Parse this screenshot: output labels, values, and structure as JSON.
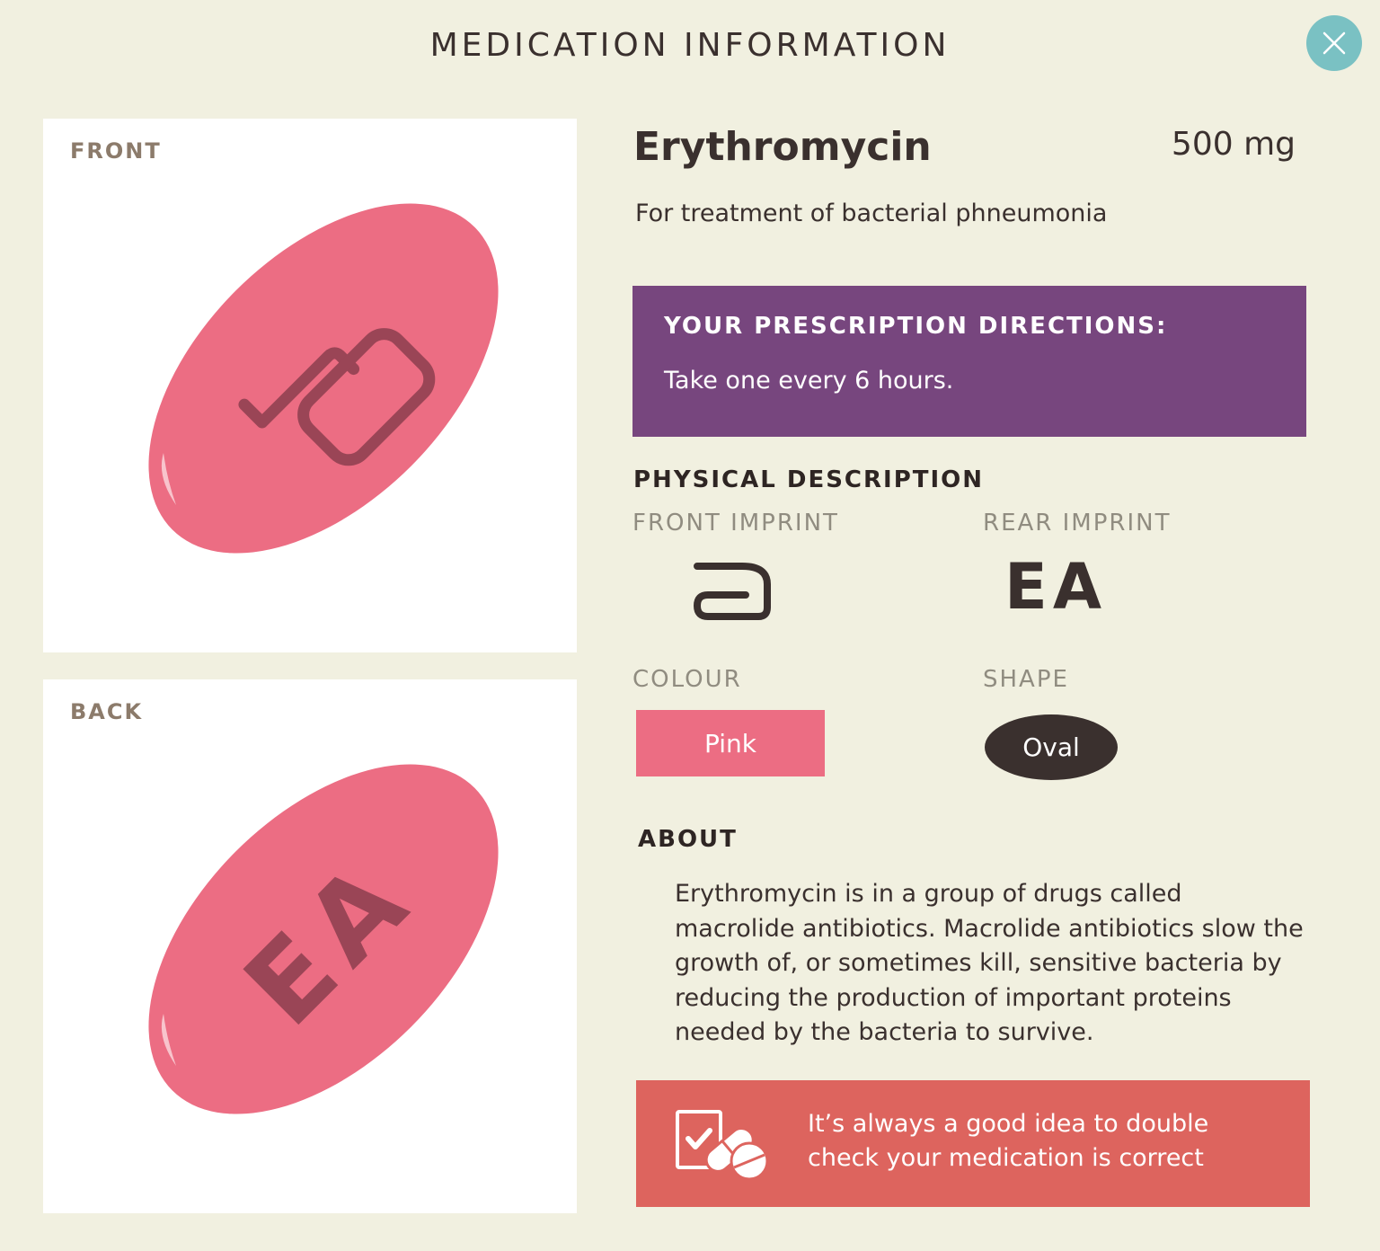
{
  "header": {
    "title": "MEDICATION INFORMATION",
    "close_icon": "close-icon"
  },
  "images": {
    "front_label": "FRONT",
    "back_label": "BACK",
    "pill_color": "#ec6d83",
    "imprint_color": "#9a4556",
    "back_imprint": "EA"
  },
  "drug": {
    "name": "Erythromycin",
    "dose": "500 mg",
    "purpose": "For treatment of bacterial phneumonia"
  },
  "directions": {
    "heading": "YOUR PRESCRIPTION DIRECTIONS:",
    "text": "Take one every 6 hours.",
    "background": "#77467e"
  },
  "physical": {
    "heading": "PHYSICAL DESCRIPTION",
    "front_imprint_label": "FRONT IMPRINT",
    "front_imprint_icon": "abbott-logo-icon",
    "rear_imprint_label": "REAR IMPRINT",
    "rear_imprint": "EA",
    "colour_label": "COLOUR",
    "colour_value": "Pink",
    "colour_hex": "#ec6d83",
    "shape_label": "SHAPE",
    "shape_value": "Oval"
  },
  "about": {
    "heading": "ABOUT",
    "text": "Erythromycin is in a group of drugs called macrolide antibiotics. Macrolide antibiotics slow the growth of, or sometimes kill, sensitive bacteria by reducing the production of important proteins needed by the bacteria to survive."
  },
  "tip": {
    "icon": "checklist-pills-icon",
    "text": "It’s always a good idea to double check your medication is correct",
    "background": "#dd645e"
  }
}
